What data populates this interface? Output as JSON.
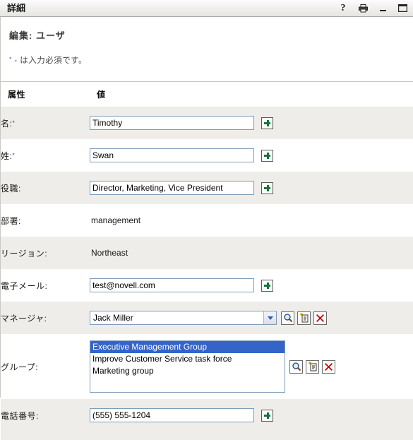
{
  "window": {
    "title": "詳細",
    "buttons": [
      {
        "name": "help",
        "glyph": "?"
      },
      {
        "name": "print",
        "glyph": "print"
      },
      {
        "name": "minimize",
        "glyph": "_"
      },
      {
        "name": "maximize",
        "glyph": "□"
      }
    ]
  },
  "header": {
    "page_title": "編集: ユーザ",
    "required_star": "*",
    "required_note": " - は入力必須です。"
  },
  "table": {
    "col_attribute": "属性",
    "col_value": "値",
    "rows": [
      {
        "label": "名:",
        "required": true,
        "type": "text",
        "value": "Timothy",
        "name": "first-name"
      },
      {
        "label": "姓:",
        "required": true,
        "type": "text",
        "value": "Swan",
        "name": "last-name"
      },
      {
        "label": "役職:",
        "required": false,
        "type": "text",
        "value": "Director, Marketing, Vice President",
        "name": "title"
      },
      {
        "label": "部署:",
        "required": false,
        "type": "static",
        "value": "management",
        "name": "department"
      },
      {
        "label": "リージョン:",
        "required": false,
        "type": "static",
        "value": "Northeast",
        "name": "region"
      },
      {
        "label": "電子メール:",
        "required": false,
        "type": "text",
        "value": "test@novell.com",
        "name": "email"
      },
      {
        "label": "マネージャ:",
        "required": false,
        "type": "select",
        "value": "Jack Miller",
        "name": "manager"
      },
      {
        "label": "グループ:",
        "required": false,
        "type": "listbox",
        "name": "group",
        "items": [
          {
            "text": "Executive Management Group",
            "selected": true
          },
          {
            "text": "Improve Customer Service task force",
            "selected": false
          },
          {
            "text": "Marketing group",
            "selected": false
          }
        ]
      },
      {
        "label": "電話番号:",
        "required": false,
        "type": "text",
        "value": "(555) 555-1204",
        "name": "phone"
      }
    ]
  },
  "icons": {
    "add": "plus-icon",
    "lookup": "magnifier-icon",
    "history": "history-icon",
    "clear": "red-x-icon"
  },
  "colors": {
    "accent_select": "#3464c8",
    "plus_green": "#16743b",
    "clear_red": "#cc0000",
    "row_shade": "#eeedea",
    "input_border": "#7f9db9"
  }
}
